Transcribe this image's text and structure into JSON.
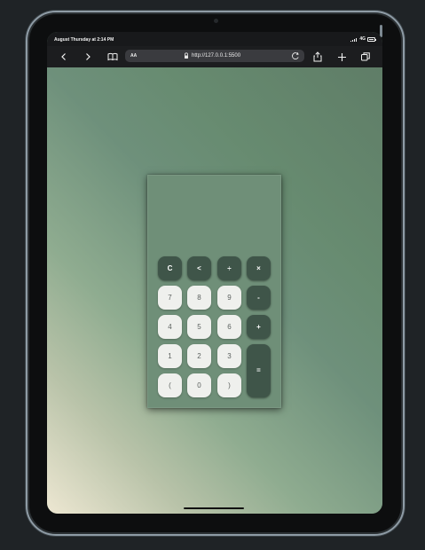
{
  "status_bar": {
    "time": "August Thursday at 2:14 PM",
    "network": "4G",
    "signal_icon": "signal-bars-icon",
    "battery_icon": "battery-icon"
  },
  "browser": {
    "reader_label": "AA",
    "url": "http://127.0.0.1:5500",
    "icons": {
      "back": "back-icon",
      "forward": "forward-icon",
      "reader": "reader-icon",
      "lock": "lock-icon",
      "reload": "reload-icon",
      "share": "share-icon",
      "new_tab": "plus-icon",
      "tabs": "tabs-icon"
    }
  },
  "calculator": {
    "display": "",
    "keys": {
      "clear": "C",
      "backspace": "<",
      "divide": "÷",
      "multiply": "×",
      "seven": "7",
      "eight": "8",
      "nine": "9",
      "minus": "-",
      "four": "4",
      "five": "5",
      "six": "6",
      "plus": "+",
      "one": "1",
      "two": "2",
      "three": "3",
      "equals": "=",
      "left_paren": "(",
      "zero": "0",
      "right_paren": ")"
    }
  },
  "colors": {
    "device_bezel": "#0d0e0f",
    "page_gradient_start": "#ede7d2",
    "page_gradient_end": "#5f7d67",
    "calculator_panel": "#6f8f78",
    "operator_key": "#3f5549",
    "number_key": "#eff0ed"
  }
}
